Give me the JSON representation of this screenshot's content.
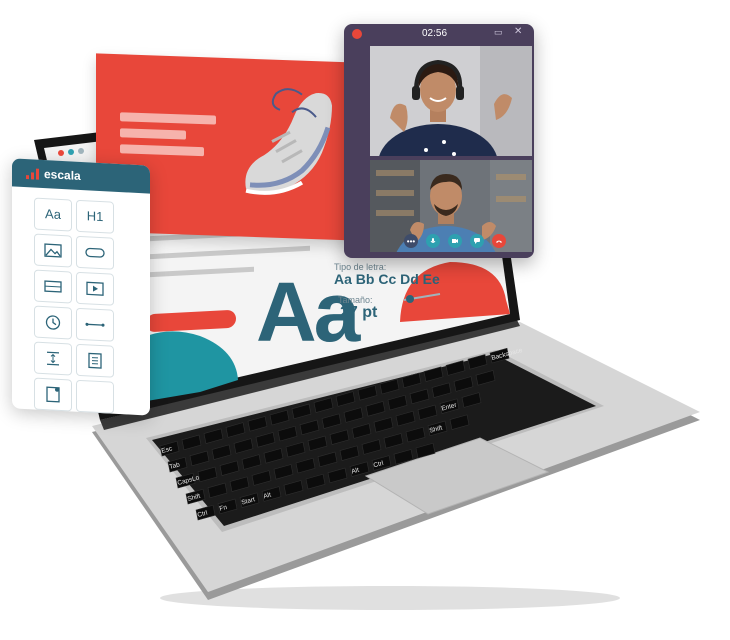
{
  "tool_panel": {
    "brand": "escala",
    "tools": [
      "Aa",
      "H1"
    ]
  },
  "typography": {
    "sample_big": "Aa",
    "font_label": "Tipo de letra:",
    "font_sample": "Aa Bb Cc Dd Ee",
    "size_label": "Tamaño:",
    "size_value": "27 pt"
  },
  "video_call": {
    "timer": "02:56"
  },
  "keyboard": {
    "keys": [
      "Esc",
      "Tab",
      "CapsLock",
      "Shift",
      "Ctrl",
      "Fn",
      "Start",
      "Alt",
      "Alt",
      "Ctrl",
      "Enter",
      "Shift",
      "Backspace"
    ]
  },
  "colors": {
    "brand_teal": "#2c6478",
    "accent_red": "#e8473a",
    "call_purple": "#4a3f5c"
  }
}
